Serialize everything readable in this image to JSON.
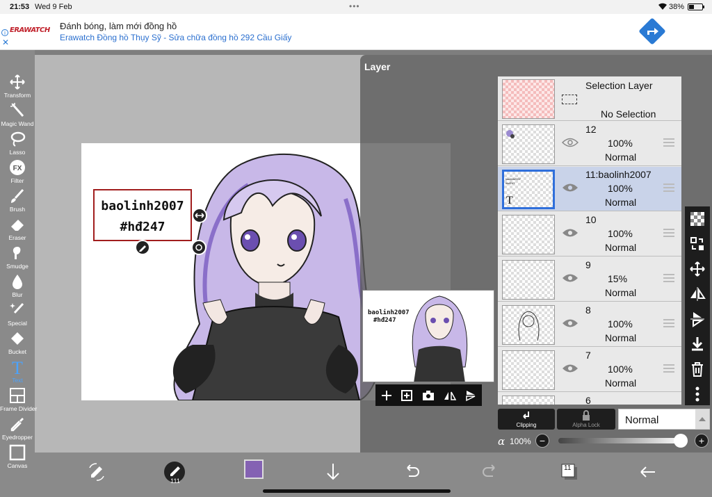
{
  "status": {
    "time": "21:53",
    "date": "Wed 9 Feb",
    "battery": "38%"
  },
  "ad": {
    "logo": "ERAWATCH",
    "title": "Đánh bóng, làm mới đồng hồ",
    "subtitle": "Erawatch Đồng hồ Thụy Sỹ - Sửa chữa đồng hồ 292 Cầu Giấy",
    "info_icon": "info-icon",
    "close_icon": "close-icon",
    "go_icon": "directions-icon"
  },
  "tools": [
    {
      "label": "Transform",
      "icon": "transform-icon"
    },
    {
      "label": "Magic Wand",
      "icon": "magic-wand-icon"
    },
    {
      "label": "Lasso",
      "icon": "lasso-icon"
    },
    {
      "label": "Filter",
      "icon": "filter-icon"
    },
    {
      "label": "Brush",
      "icon": "brush-icon"
    },
    {
      "label": "Eraser",
      "icon": "eraser-icon"
    },
    {
      "label": "Smudge",
      "icon": "smudge-icon"
    },
    {
      "label": "Blur",
      "icon": "blur-icon"
    },
    {
      "label": "Special",
      "icon": "special-icon"
    },
    {
      "label": "Bucket",
      "icon": "bucket-icon"
    },
    {
      "label": "Text",
      "icon": "text-icon",
      "active": true
    },
    {
      "label": "Frame Divider",
      "icon": "frame-divider-icon"
    },
    {
      "label": "Eyedropper",
      "icon": "eyedropper-icon"
    },
    {
      "label": "Canvas",
      "icon": "canvas-icon"
    }
  ],
  "canvas_text": {
    "line1": "baolinh2007",
    "line2": "#hđ247"
  },
  "layer_panel": {
    "title": "Layer",
    "selection_layer": {
      "name": "Selection Layer",
      "status": "No Selection"
    },
    "layers": [
      {
        "name": "12",
        "opacity": "100%",
        "mode": "Normal"
      },
      {
        "name": "11:baolinh2007",
        "opacity": "100%",
        "mode": "Normal",
        "selected": true,
        "thumb_text": "baolinh2007 #hđ247",
        "type_glyph": "T"
      },
      {
        "name": "10",
        "opacity": "100%",
        "mode": "Normal"
      },
      {
        "name": "9",
        "opacity": "15%",
        "mode": "Normal"
      },
      {
        "name": "8",
        "opacity": "100%",
        "mode": "Normal"
      },
      {
        "name": "7",
        "opacity": "100%",
        "mode": "Normal"
      },
      {
        "name": "6",
        "opacity": "",
        "mode": ""
      }
    ],
    "clipping_label": "Clipping",
    "alpha_lock_label": "Alpha Lock",
    "blend_mode": "Normal",
    "alpha_symbol": "α",
    "alpha_value": "100%",
    "minus": "−",
    "plus": "+",
    "opacity_fraction": 1.0
  },
  "reference": {
    "line1": "baolinh2007",
    "line2": "#hđ247"
  },
  "bottom": {
    "pen_size": "111",
    "layer_count": "11",
    "color": "#8462b3"
  }
}
